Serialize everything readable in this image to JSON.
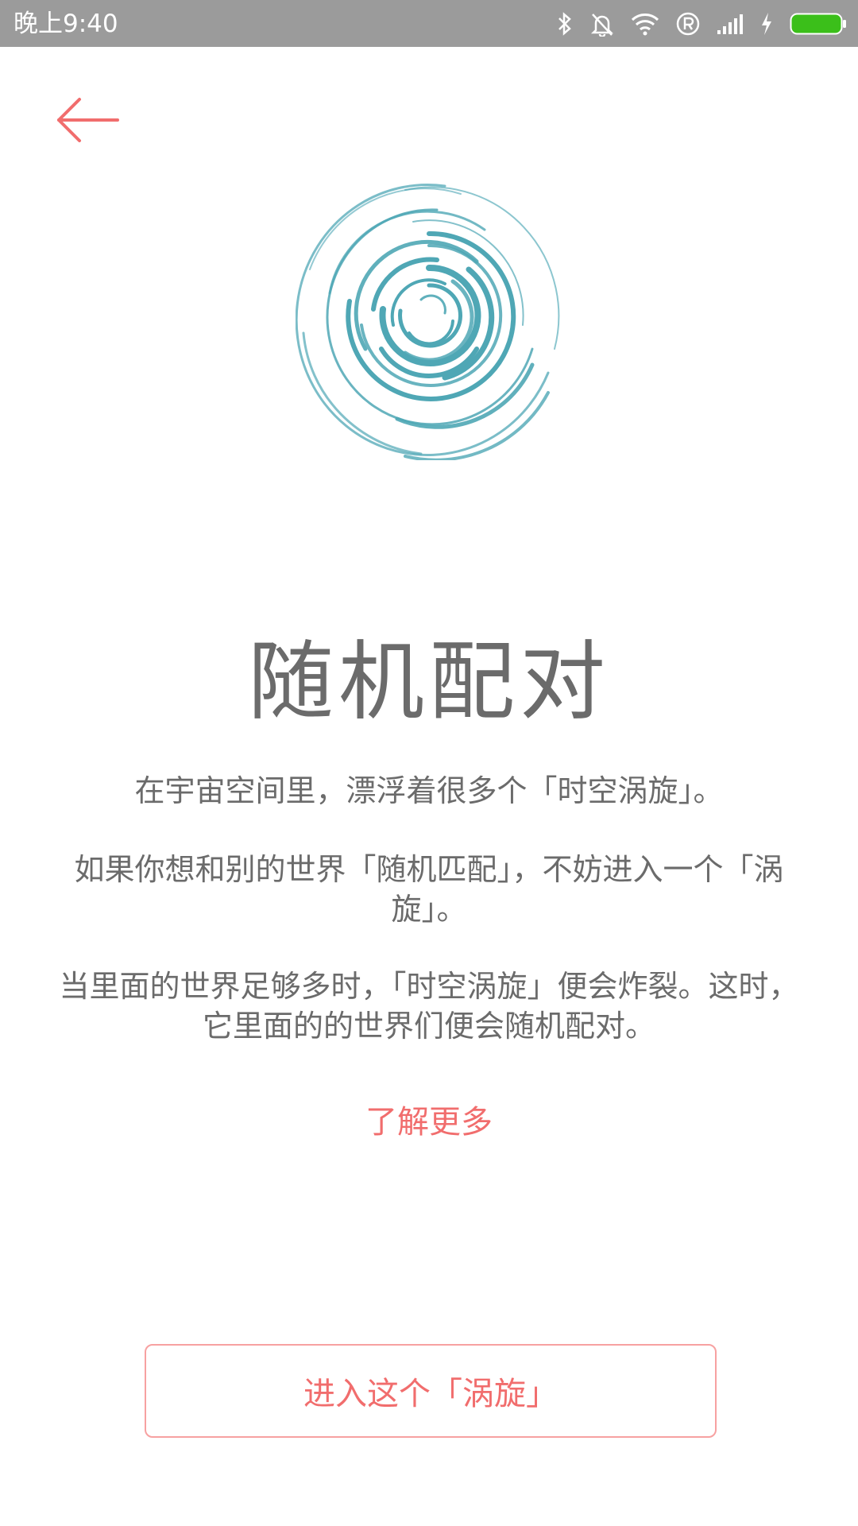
{
  "status_bar": {
    "time": "晚上9:40",
    "icons": [
      "bluetooth-icon",
      "alarm-off-icon",
      "wifi-icon",
      "roaming-icon",
      "signal-icon",
      "charging-icon",
      "battery-icon"
    ],
    "battery_color": "#3bbf1a"
  },
  "nav": {
    "back_icon": "arrow-left-icon",
    "accent": "#f16d6d"
  },
  "hero": {
    "icon": "vortex-icon",
    "color": "#4fa7b5"
  },
  "title": "随机配对",
  "paragraphs": {
    "p1": "在宇宙空间里，漂浮着很多个「时空涡旋」。",
    "p2": "如果你想和别的世界「随机匹配」，不妨进入一个「涡旋」。",
    "p3": "当里面的世界足够多时，「时空涡旋」便会炸裂。这时，它里面的的世界们便会随机配对。"
  },
  "learn_more": "了解更多",
  "enter_button": "进入这个「涡旋」"
}
